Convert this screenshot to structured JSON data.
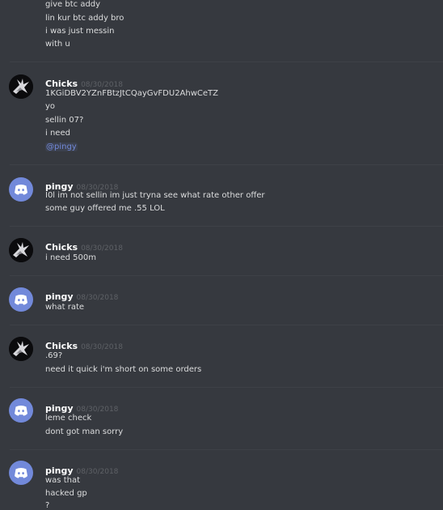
{
  "top_lines": [
    "give btc addy",
    "lin kur btc addy bro",
    "i was just messin",
    "with u"
  ],
  "groups": [
    {
      "author": "Chicks",
      "avatar": "chicks-avatar",
      "timestamp": "08/30/2018",
      "lines": [
        "1KGiDBV2YZnFBtzJtCQayGvFDU2AhwCeTZ",
        "yo",
        "sellin 07?",
        "i need"
      ],
      "mention": "@pingy"
    },
    {
      "author": "pingy",
      "avatar": "discord-avatar",
      "timestamp": "08/30/2018",
      "lines": [
        "I0l im not sellin im just tryna see what rate other offer",
        "some guy offered me .55 LOL"
      ]
    },
    {
      "author": "Chicks",
      "avatar": "chicks-avatar",
      "timestamp": "08/30/2018",
      "lines": [
        "i need 500m"
      ]
    },
    {
      "author": "pingy",
      "avatar": "discord-avatar",
      "timestamp": "08/30/2018",
      "lines": [
        "what rate"
      ]
    },
    {
      "author": "Chicks",
      "avatar": "chicks-avatar",
      "timestamp": "08/30/2018",
      "lines": [
        ".69?",
        "need it quick i'm short on some orders"
      ]
    },
    {
      "author": "pingy",
      "avatar": "discord-avatar",
      "timestamp": "08/30/2018",
      "lines": [
        "leme check",
        "dont got man sorry"
      ]
    },
    {
      "author": "pingy",
      "avatar": "discord-avatar",
      "timestamp": "08/30/2018",
      "lines": [
        "was that",
        "hacked gp",
        "?"
      ]
    }
  ]
}
